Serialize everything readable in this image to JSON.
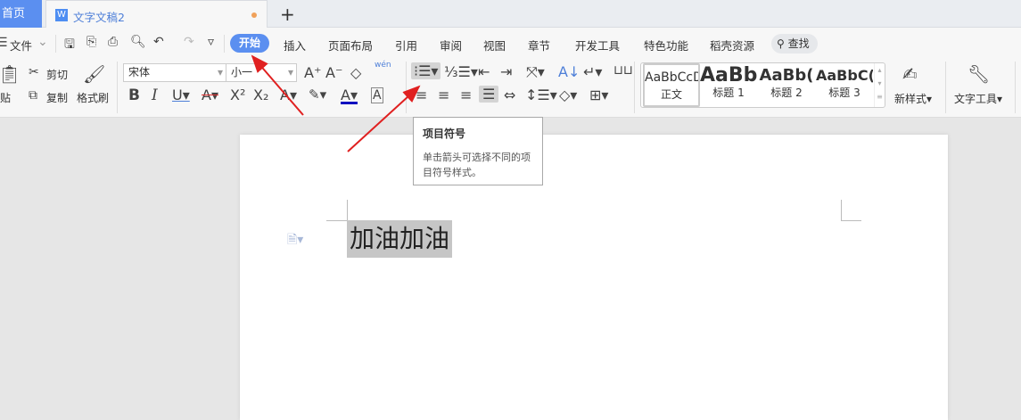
{
  "tabs": {
    "home": "首页",
    "doc": "文字文稿2",
    "doc_icon": "W",
    "new_tab": "+"
  },
  "menu": {
    "file": "文件",
    "items": [
      "开始",
      "插入",
      "页面布局",
      "引用",
      "审阅",
      "视图",
      "章节",
      "开发工具",
      "特色功能",
      "稻壳资源"
    ],
    "find": "查找"
  },
  "clipboard": {
    "paste": "贴",
    "cut": "剪切",
    "copy": "复制",
    "format_painter": "格式刷"
  },
  "font": {
    "name": "宋体",
    "size": "小一",
    "pinyin": "wén"
  },
  "styles": [
    {
      "preview": "AaBbCcD",
      "name": "正文"
    },
    {
      "preview": "AaBb",
      "name": "标题 1"
    },
    {
      "preview": "AaBb(",
      "name": "标题 2"
    },
    {
      "preview": "AaBbC(",
      "name": "标题 3"
    }
  ],
  "new_style": "新样式",
  "text_tools": "文字工具",
  "tooltip": {
    "title": "项目符号",
    "body": "单击箭头可选择不同的项目符号样式。"
  },
  "document": {
    "text": "加油加油"
  },
  "colors": {
    "accent": "#5b8ff0",
    "arrow": "#e02020"
  }
}
